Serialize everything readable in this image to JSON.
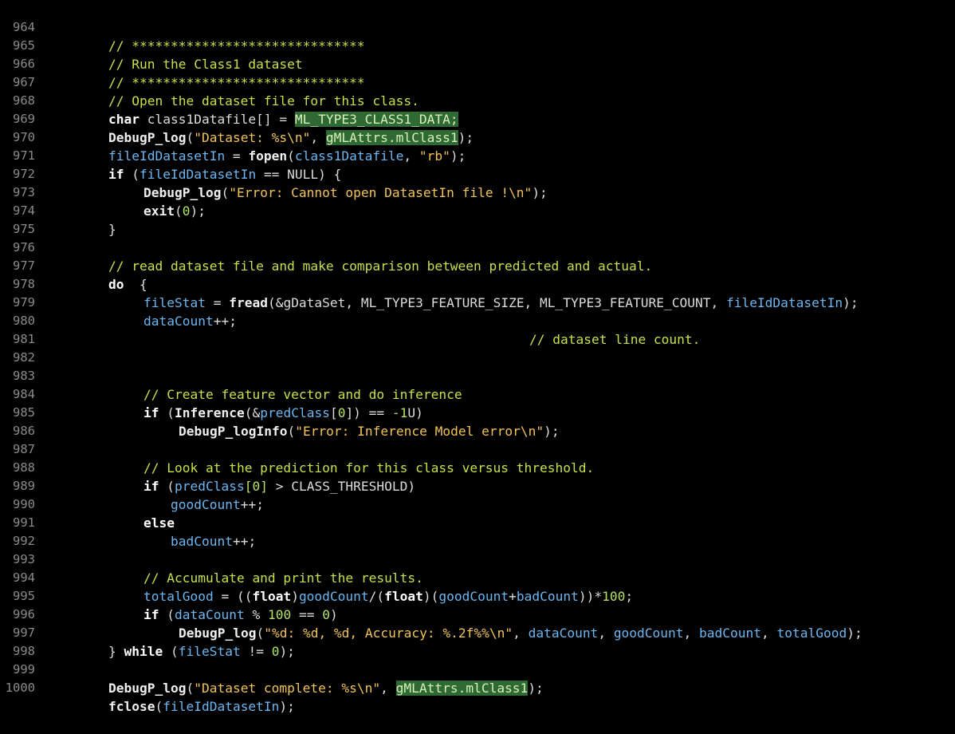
{
  "editor": {
    "line_numbers": [
      "964",
      "965",
      "966",
      "967",
      "968",
      "969",
      "970",
      "971",
      "972",
      "973",
      "974",
      "975",
      "976",
      "977",
      "978",
      "979",
      "980",
      "981",
      "982",
      "983",
      "984",
      "985",
      "986",
      "987",
      "988",
      "989",
      "990",
      "991",
      "992",
      "993",
      "994",
      "995",
      "996",
      "997",
      "998",
      "999",
      "1000"
    ],
    "tokens": {
      "l964": "// ******************************",
      "l965": "// Run the Class1 dataset",
      "l966": "// ******************************",
      "l967": "// Open the dataset file for this class.",
      "l968_kw": "char",
      "l968_var": " class1Datafile[] = ",
      "l968_hl": "ML_TYPE3_CLASS1_DATA;",
      "l969_fn": "DebugP_log",
      "l969_p1": "(",
      "l969_s": "\"Dataset: %s\\n\"",
      "l969_p2": ", ",
      "l969_hl": "gMLAttrs.mlClass1",
      "l969_p3": ");",
      "l970_v": "fileIdDatasetIn",
      "l970_p1": " = ",
      "l970_fn": "fopen",
      "l970_p2": "(",
      "l970_v2": "class1Datafile",
      "l970_p3": ", ",
      "l970_s": "\"rb\"",
      "l970_p4": ");",
      "l971_kw": "if",
      "l971_p1": " (",
      "l971_v": "fileIdDatasetIn",
      "l971_p2": " == NULL) {",
      "l972_fn": "DebugP_log",
      "l972_p1": "(",
      "l972_s": "\"Error: Cannot open DatasetIn file !\\n\"",
      "l972_p2": ");",
      "l973_fn": "exit",
      "l973_p1": "(",
      "l973_n": "0",
      "l973_p2": ");",
      "l974": "}",
      "l976": "// read dataset file and make comparison between predicted and actual.",
      "l977_kw": "do",
      "l977_p": "  {",
      "l978_v": "fileStat",
      "l978_p1": " = ",
      "l978_fn": "fread",
      "l978_p2": "(&gDataSet, ML_TYPE3_FEATURE_SIZE, ML_TYPE3_FEATURE_COUNT, ",
      "l978_v2": "fileIdDatasetIn",
      "l978_p3": ");",
      "l979_v": "dataCount",
      "l979_p": "++;",
      "l979_c": "// dataset line count.",
      "l983": "// Create feature vector and do inference",
      "l984_kw": "if",
      "l984_p1": " (",
      "l984_fn": "Inference",
      "l984_p2": "(&",
      "l984_v": "predClass",
      "l984_p3": "[",
      "l984_n": "0",
      "l984_p4": "]) == ",
      "l984_n2": "-1",
      "l984_p5": "U)",
      "l985_fn": "DebugP_logInfo",
      "l985_p1": "(",
      "l985_s": "\"Error: Inference Model error\\n\"",
      "l985_p2": ");",
      "l987": "// Look at the prediction for this class versus threshold.",
      "l988_kw": "if",
      "l988_p1": " (",
      "l988_v": "predClass",
      "l988_n": "[0]",
      "l988_p2": " > CLASS_THRESHOLD)",
      "l989_v": "goodCount",
      "l989_p": "++;",
      "l990_kw": "else",
      "l991_v": "badCount",
      "l991_p": "++;",
      "l993": "// Accumulate and print the results.",
      "l994_v": "totalGood",
      "l994_p1": " = ((",
      "l994_kw": "float",
      "l994_p2": ")",
      "l994_v2": "goodCount",
      "l994_p3": "/(",
      "l994_kw2": "float",
      "l994_p4": ")(",
      "l994_v3": "goodCount",
      "l994_p5": "+",
      "l994_v4": "badCount",
      "l994_p6": "))*",
      "l994_n": "100",
      "l994_p7": ";",
      "l995_kw": "if",
      "l995_p1": " (",
      "l995_v": "dataCount",
      "l995_p2": " % ",
      "l995_n": "100",
      "l995_p3": " == ",
      "l995_n2": "0",
      "l995_p4": ")",
      "l996_fn": "DebugP_log",
      "l996_p1": "(",
      "l996_s": "\"%d: %d, %d, Accuracy: %.2f%%\\n\"",
      "l996_p2": ", ",
      "l996_v": "dataCount",
      "l996_p3": ", ",
      "l996_v2": "goodCount",
      "l996_p4": ", ",
      "l996_v3": "badCount",
      "l996_p5": ", ",
      "l996_v4": "totalGood",
      "l996_p6": ");",
      "l997_p1": "} ",
      "l997_kw": "while",
      "l997_p2": " (",
      "l997_v": "fileStat",
      "l997_p3": " != ",
      "l997_n": "0",
      "l997_p4": ");",
      "l999_fn": "DebugP_log",
      "l999_p1": "(",
      "l999_s": "\"Dataset complete: %s\\n\"",
      "l999_p2": ", ",
      "l999_hl": "gMLAttrs.mlClass1",
      "l999_p3": ");",
      "l1000_fn": "fclose",
      "l1000_p1": "(",
      "l1000_v": "fileIdDatasetIn",
      "l1000_p2": ");"
    }
  },
  "colors": {
    "background": "#000000",
    "line_number": "#8a8a8a",
    "comment": "#c8e04a",
    "variable": "#6cb6f0",
    "string": "#f2c35a",
    "highlight_bg": "#2f6a35"
  }
}
